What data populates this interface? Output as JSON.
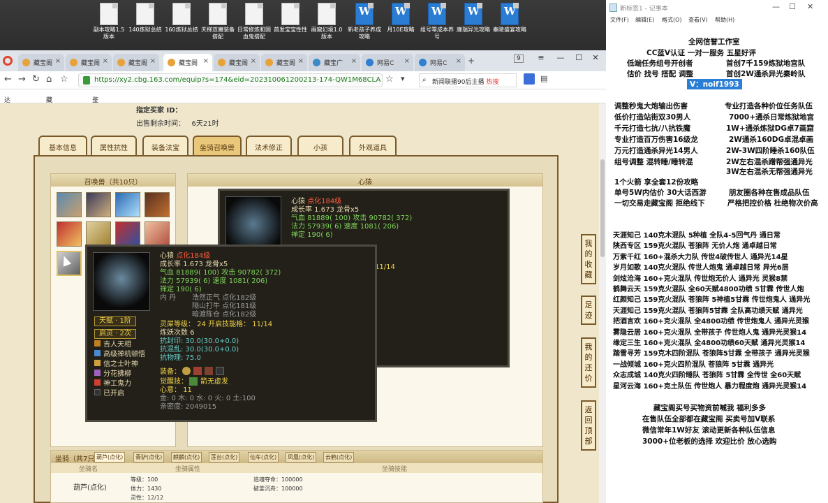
{
  "desktop": {
    "icons": [
      {
        "label": "副本攻略1.5版本",
        "type": "doc"
      },
      {
        "label": "140炼狱总结",
        "type": "doc"
      },
      {
        "label": "160炼狱总结",
        "type": "doc"
      },
      {
        "label": "天梯双魔装备搭配",
        "type": "doc"
      },
      {
        "label": "日常修炼和固血鬼搭配",
        "type": "doc"
      },
      {
        "label": "首发宝宝性性",
        "type": "doc"
      },
      {
        "label": "画窟幻境1.0版本",
        "type": "doc"
      },
      {
        "label": "新老孩子养成攻略",
        "type": "word"
      },
      {
        "label": "月10E攻略",
        "type": "word"
      },
      {
        "label": "组号零成本养号",
        "type": "word"
      },
      {
        "label": "廉瑞异光攻略",
        "type": "word"
      },
      {
        "label": "秦陵盛宴攻略",
        "type": "word"
      }
    ]
  },
  "browser": {
    "tabs": [
      "藏宝阁",
      "藏宝阁",
      "藏宝阁",
      "藏宝阁",
      "藏宝阁",
      "藏宝阁",
      "藏宝广",
      "网易C",
      "网易C"
    ],
    "tab_count": "9",
    "url": "https://xy2.cbg.163.com/equip?s=174&eid=202310061200213-174-QW1M68CLAOFD&c",
    "search_text": "新闻联播90后主播",
    "search_hot": "热搜",
    "bookmarks": [
      "达人后台主",
      "藏宝阁_C",
      "鉴宝广场"
    ]
  },
  "listing": {
    "buyer_label": "指定买家 ID：",
    "remaining_label": "出售剩余时间：",
    "remaining_value": "6天21时"
  },
  "page_tabs": [
    "基本信息",
    "属性抗性",
    "装备法宝",
    "坐骑召唤兽",
    "法术修正",
    "小孩",
    "外观道具"
  ],
  "active_page_tab": "坐骑召唤兽",
  "summon": {
    "header": "召唤兽（共10只）",
    "detail_header": "心猿"
  },
  "pet_detail": {
    "name": "心猿",
    "realm": "点化184级",
    "growth": "成长率 1.673 龙骨x5",
    "hp": "气血 81889( 100) 攻击 90782( 372)",
    "mp": "法力 57939( 6) 速度 1081( 206)",
    "zen": "禅定 190( 6)",
    "neidan_label": "内   丹",
    "neidan1": "浩然正气 点化182级",
    "neidan2": "隔山打牛 点化181级",
    "neidan3": "暗渡陈仓 点化182级",
    "tianfu": "天赋 · 1阶",
    "qiling": "启灵 · 2次",
    "skills": [
      "吉人天相",
      "高级禅机顿悟",
      "信之士叶神",
      "分花拂柳",
      "神工鬼力",
      "已开启"
    ],
    "spirit_level": "灵犀等级：  24 开启技能格：  11/14",
    "refine": "炼妖次数 6",
    "resist_seal": "抗封印: 30.0(30.0+0.0)",
    "resist_chaos": "抗混乱: 30.0(30.0+0.0)",
    "resist_phys": "抗物理: 75.0",
    "equip_label": "装备：",
    "awaken_label": "觉醒技：",
    "awaken_skill": "箭无虚发",
    "xindian": "心意：  11",
    "elements": "金: 0 木: 0 水: 0 火: 0 土:100",
    "intimacy": "亲密度: 2049015",
    "back_progress": "11/14"
  },
  "mount": {
    "header": "坐骑（共7只）",
    "tabs": [
      "葫芦(点化)",
      "青驴(点化)",
      "麒麟(点化)",
      "莲台(点化)",
      "仙车(点化)",
      "凤凰(点化)",
      "云鹤(点化)"
    ],
    "col_name": "坐骑名",
    "col_attr": "坐骑属性",
    "col_skill": "坐骑技能",
    "name": "葫芦(点化)",
    "level": "等级：100",
    "vitality": "体力：1430",
    "spirit": "灵性：12/12",
    "skill1": "追魂夺命：100000",
    "skill2": "破釜沉舟：100000"
  },
  "side_buttons": [
    "我的收藏",
    "足迹",
    "我的还价",
    "返回顶部"
  ],
  "notepad": {
    "title": "新标签1 - 记事本",
    "menu": [
      "文件(F)",
      "编辑(E)",
      "格式(O)",
      "查看(V)",
      "帮助(H)"
    ],
    "header_lines": [
      "全网信誉工作室",
      "CC蓝V认证  一对一服务 五星好评",
      "低端任务组号开创者",
      "首创7千159炼狱地宫队",
      "估价 找号 搭配 调整",
      "首创2W通杀异光秦岭队",
      "V：noif1993"
    ],
    "service_left": [
      "调整秒鬼大炮输出伤害",
      "低价打造站街双30男人",
      "千元打造七抗/八抗铁魔",
      "专业打造百万伤害16级龙",
      "万元打造通杀异光14男人",
      "组号调整 混转睡/睡转混"
    ],
    "service_right": [
      "专业打造各种价位任务队伍",
      "7000+通杀日常炼狱地宫",
      "1W+通杀炼狱DG卓7画窟",
      "2W通杀160DG卓混卓画",
      "2W-3W四阶睡杀160队伍",
      "2W左右混杀蹭帮强通异光",
      "3W左右混杀无帮强通异光"
    ],
    "mid_lines": [
      "1个火箭 享全套12份攻略",
      "单号5W内估价 30大话西游",
      "朋友圈各种在售成品队伍",
      "一切交易走藏宝阁 拒绝线下",
      "严格把控价格 杜绝物次价高"
    ],
    "teams": [
      "天涯知己 140克木混队 5种植 全队4-5回气丹 通日常",
      "陕西专区 159克火混队 苍狼阵 无价人炮 通卓越日常",
      "万紫千红 160+混杀大力队 传世4破传世人 通异光14星",
      "岁月如歌 140克火混队 传世人炮鬼 通卓越日常 异光6层",
      "剑炫沧海 160+克火混队 传世炮无价人 通异光 灵猴8禁",
      "鹤舞云天 159克火混队 全60天赋4800功绩 5甘霖 传世人炮",
      "红颜知己 159克火混队 苍狼阵 5神植5甘霖 传世炮鬼人 通异光",
      "天涯知己 159克火混队 苍狼阵5甘霖 全队高功绩天赋 通异光",
      "把酒言欢 160+克火混队 全4800功绩 传世炮鬼人 通异光灵猴",
      "雾隐云居 160+克火混队 全带孩子 传世炮人鬼 通异光灵猴14",
      "缘定三生 160+克火混队 全4800功绩60天赋 通异光灵猴14",
      "踏雪寻芳 159克木四阶混队 苍狼阵5甘霖 全带孩子 通异光灵猴",
      "一战倾城 160+克火四阶混队 苍狼阵 5甘霖 通异光",
      "众志成城 140克火四阶睡队 苍狼阵 5甘霖 全传世 全60天赋",
      "星河云海 160+克土队伍 传世炮人 暴力程度炮 通异光灵猴14"
    ],
    "footer": [
      "藏宝阁买号买物资前喊我 福利多多",
      "在售队伍全部都在藏宝阁 买卖号加V联系",
      "微信常年1W好友 滚动更新各种队伍信息",
      "3000+位老板的选择 欢迎比价 放心选购"
    ]
  }
}
